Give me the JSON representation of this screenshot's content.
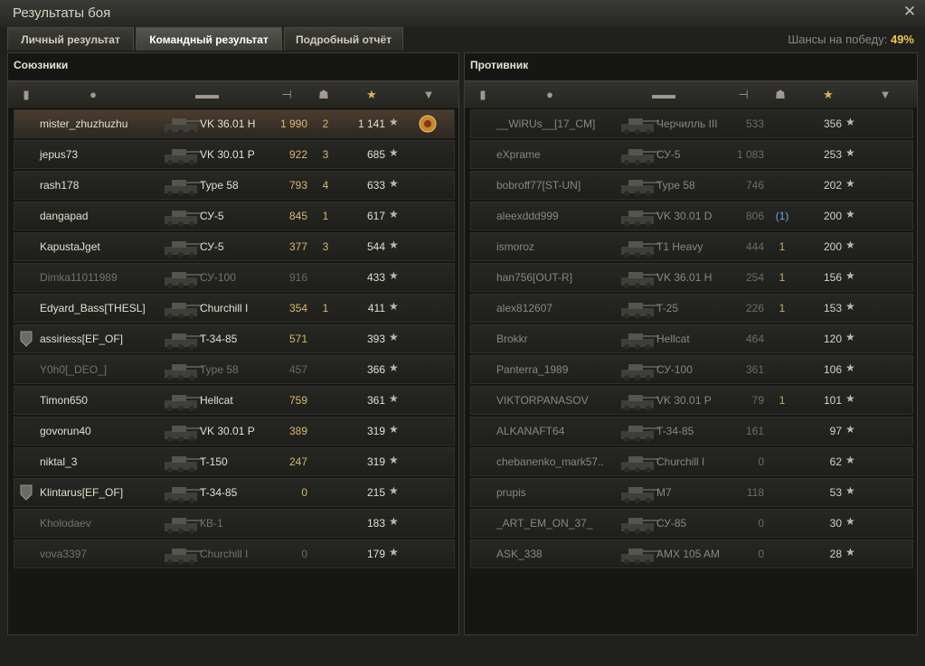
{
  "window": {
    "title": "Результаты боя",
    "close_icon": "close-icon"
  },
  "tabs": [
    {
      "label": "Личный результат",
      "active": false
    },
    {
      "label": "Командный результат",
      "active": true
    },
    {
      "label": "Подробный отчёт",
      "active": false
    }
  ],
  "chance": {
    "label": "Шансы на победу:",
    "value": "49%"
  },
  "allies": {
    "title": "Союзники",
    "rows": [
      {
        "name": "mister_zhuzhuzhu",
        "vehicle": "VK 36.01 H",
        "damage": "1 990",
        "kills": "2",
        "xp": "1 141",
        "highlight": true,
        "medal": true
      },
      {
        "name": "jepus73",
        "vehicle": "VK 30.01 P",
        "damage": "922",
        "kills": "3",
        "xp": "685"
      },
      {
        "name": "rash178",
        "vehicle": "Type 58",
        "damage": "793",
        "kills": "4",
        "xp": "633"
      },
      {
        "name": "dangapad",
        "vehicle": "СУ-5",
        "damage": "845",
        "kills": "1",
        "xp": "617"
      },
      {
        "name": "KapustaJget",
        "vehicle": "СУ-5",
        "damage": "377",
        "kills": "3",
        "xp": "544"
      },
      {
        "name": "Dimka11011989",
        "vehicle": "СУ-100",
        "damage": "916",
        "kills": "",
        "xp": "433",
        "dead": true
      },
      {
        "name": "Edyard_Bass[THESL]",
        "vehicle": "Churchill I",
        "damage": "354",
        "kills": "1",
        "xp": "411"
      },
      {
        "name": "assiriess[EF_OF]",
        "vehicle": "T-34-85",
        "damage": "571",
        "kills": "",
        "xp": "393",
        "badge": true
      },
      {
        "name": "Y0h0[_DEO_]",
        "vehicle": "Type 58",
        "damage": "457",
        "kills": "",
        "xp": "366",
        "dead": true
      },
      {
        "name": "Timon650",
        "vehicle": "Hellcat",
        "damage": "759",
        "kills": "",
        "xp": "361"
      },
      {
        "name": "govorun40",
        "vehicle": "VK 30.01 P",
        "damage": "389",
        "kills": "",
        "xp": "319"
      },
      {
        "name": "niktal_3",
        "vehicle": "T-150",
        "damage": "247",
        "kills": "",
        "xp": "319"
      },
      {
        "name": "Klintarus[EF_OF]",
        "vehicle": "T-34-85",
        "damage": "0",
        "kills": "",
        "xp": "215",
        "badge": true
      },
      {
        "name": "Kholodaev",
        "vehicle": "КВ-1",
        "damage": "",
        "kills": "",
        "xp": "183",
        "dead": true
      },
      {
        "name": "vova3397",
        "vehicle": "Churchill I",
        "damage": "0",
        "kills": "",
        "xp": "179",
        "dead": true
      }
    ]
  },
  "enemies": {
    "title": "Противник",
    "rows": [
      {
        "name": "__WiRUs__[17_CM]",
        "vehicle": "Черчилль III",
        "damage": "533",
        "kills": "",
        "xp": "356"
      },
      {
        "name": "eXprame",
        "vehicle": "СУ-5",
        "damage": "1 083",
        "kills": "",
        "xp": "253"
      },
      {
        "name": "bobroff77[ST-UN]",
        "vehicle": "Type 58",
        "damage": "746",
        "kills": "",
        "xp": "202"
      },
      {
        "name": "aleexddd999",
        "vehicle": "VK 30.01 D",
        "damage": "806",
        "kills": "(1)",
        "xp": "200",
        "kills_blue": true
      },
      {
        "name": "ismoroz",
        "vehicle": "T1 Heavy",
        "damage": "444",
        "kills": "1",
        "xp": "200"
      },
      {
        "name": "han756[OUT-R]",
        "vehicle": "VK 36.01 H",
        "damage": "254",
        "kills": "1",
        "xp": "156"
      },
      {
        "name": "alex812607",
        "vehicle": "T-25",
        "damage": "226",
        "kills": "1",
        "xp": "153"
      },
      {
        "name": "Brokkr",
        "vehicle": "Hellcat",
        "damage": "464",
        "kills": "",
        "xp": "120"
      },
      {
        "name": "Panterra_1989",
        "vehicle": "СУ-100",
        "damage": "361",
        "kills": "",
        "xp": "106"
      },
      {
        "name": "VIKTORPANASOV",
        "vehicle": "VK 30.01 P",
        "damage": "79",
        "kills": "1",
        "xp": "101"
      },
      {
        "name": "ALKANAFT64",
        "vehicle": "T-34-85",
        "damage": "161",
        "kills": "",
        "xp": "97"
      },
      {
        "name": "chebanenko_mark57..",
        "vehicle": "Churchill I",
        "damage": "0",
        "kills": "",
        "xp": "62"
      },
      {
        "name": "prupis",
        "vehicle": "M7",
        "damage": "118",
        "kills": "",
        "xp": "53"
      },
      {
        "name": "_ART_EM_ON_37_",
        "vehicle": "СУ-85",
        "damage": "0",
        "kills": "",
        "xp": "30"
      },
      {
        "name": "ASK_338",
        "vehicle": "AMX 105 AM",
        "damage": "0",
        "kills": "",
        "xp": "28"
      }
    ]
  },
  "star_glyph": "★"
}
